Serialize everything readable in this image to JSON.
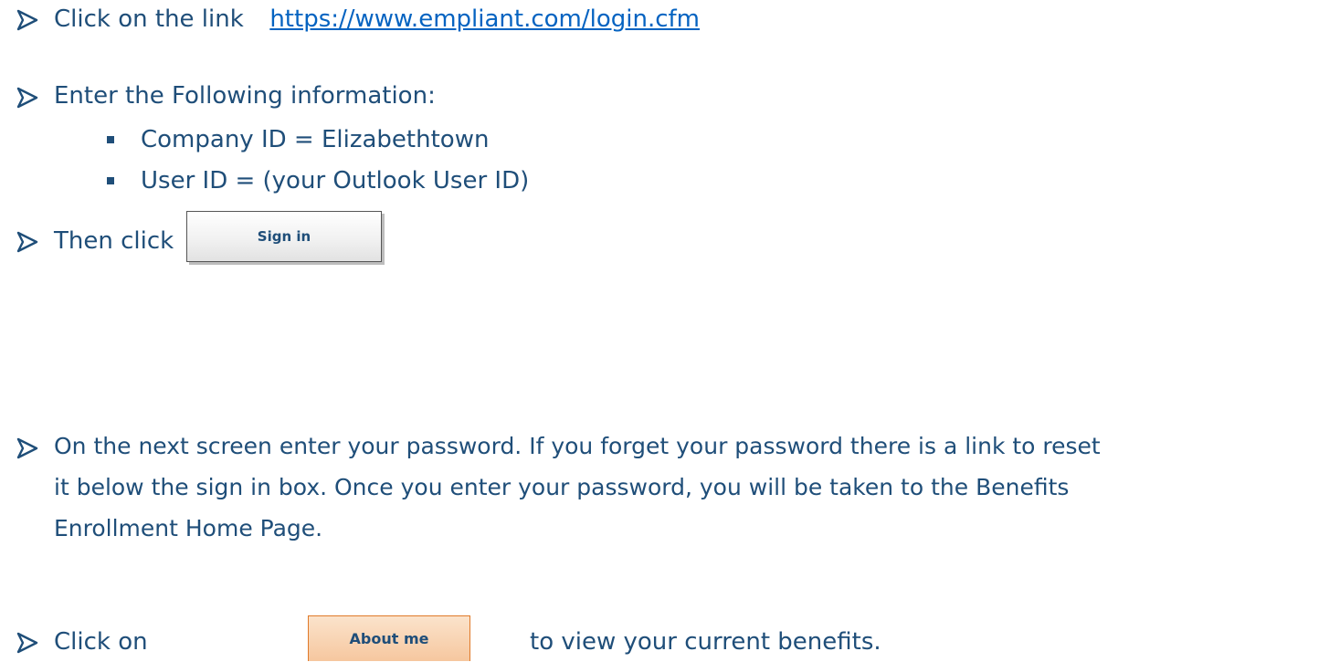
{
  "steps": {
    "step1": {
      "text": "Click on the link",
      "link": "https://www.empliant.com/login.cfm"
    },
    "step2": {
      "text": "Enter the Following information:",
      "sub_items": [
        "Company ID = Elizabethtown",
        "User ID = (your Outlook User ID)"
      ]
    },
    "step3": {
      "text": "Then click",
      "button_label": "Sign in"
    },
    "step4": {
      "lines": [
        "On the next screen enter your password.  If you forget your password there is a link to reset",
        "it below the sign in box.  Once you enter your password, you will be taken to the Benefits",
        "Enrollment Home Page."
      ]
    },
    "step5": {
      "text": "Click on",
      "button_label": "About me",
      "suffix": "to view your current benefits."
    }
  },
  "colors": {
    "text": "#1f4e79",
    "link": "#0563c1",
    "about_button_fill": "#f6c79f",
    "about_button_border": "#e07a2a"
  },
  "icons": {
    "step_bullet": "arrow-bullet-icon",
    "sub_bullet": "square-bullet-icon"
  }
}
